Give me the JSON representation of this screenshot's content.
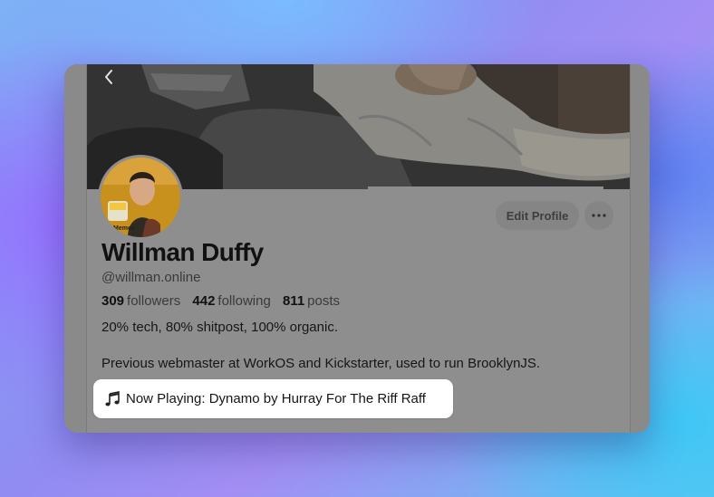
{
  "profile": {
    "display_name": "Willman Duffy",
    "handle": "@willman.online",
    "edit_label": "Edit Profile",
    "stats": {
      "followers_count": "309",
      "followers_label": "followers",
      "following_count": "442",
      "following_label": "following",
      "posts_count": "811",
      "posts_label": "posts"
    },
    "bio_line1": "20% tech, 80% shitpost, 100% organic.",
    "bio_line2": "Previous webmaster at WorkOS and Kickstarter, used to run BrooklynJS.",
    "avatar_caption": "Memes"
  },
  "now_playing": {
    "text": "Now Playing: Dynamo by Hurray For The Riff Raff"
  },
  "icons": {
    "back": "chevron-left-icon",
    "more": "ellipsis-icon",
    "music": "music-note-icon"
  },
  "colors": {
    "overlay_gray": "#8e8e8e",
    "text_primary": "#111111",
    "now_playing_bg": "#ffffff"
  }
}
